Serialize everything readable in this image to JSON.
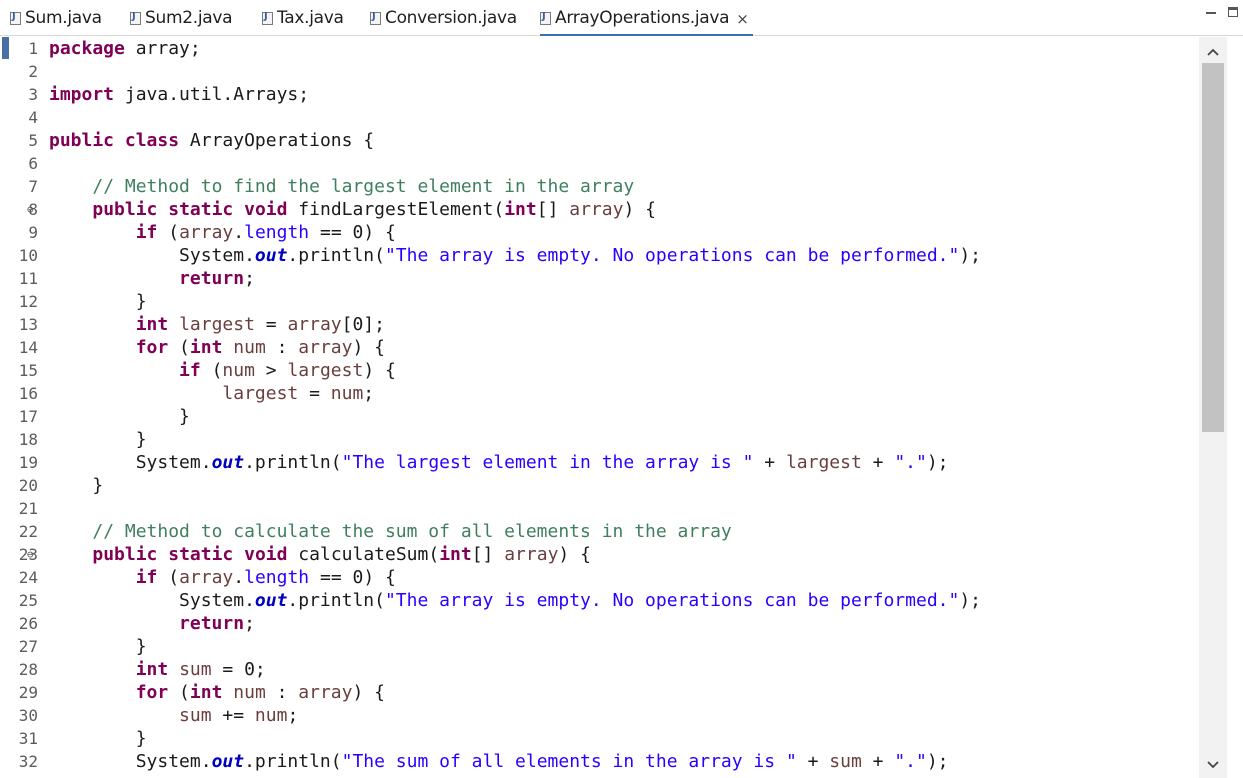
{
  "tabs": [
    {
      "label": "Sum.java",
      "active": false
    },
    {
      "label": "Sum2.java",
      "active": false
    },
    {
      "label": "Tax.java",
      "active": false
    },
    {
      "label": "Conversion.java",
      "active": false
    },
    {
      "label": "ArrayOperations.java",
      "active": true
    }
  ],
  "icons": {
    "file": "java-file-icon",
    "close": "×",
    "scroll_up": "chevron-up-icon",
    "scroll_down": "chevron-down-icon",
    "fold": "fold-collapse-icon"
  },
  "colors": {
    "keyword": "#7f0055",
    "string": "#2a00ff",
    "comment": "#3f7f5f",
    "static_field": "#0000c0",
    "parameter": "#6a3e3e",
    "active_tab_underline": "#3b6fb6"
  },
  "code_lines": [
    {
      "n": "1",
      "fold": false,
      "tokens": [
        [
          "kw",
          "package"
        ],
        [
          "p",
          " array;"
        ]
      ]
    },
    {
      "n": "2",
      "fold": false,
      "tokens": []
    },
    {
      "n": "3",
      "fold": false,
      "tokens": [
        [
          "kw",
          "import"
        ],
        [
          "p",
          " java.util.Arrays;"
        ]
      ]
    },
    {
      "n": "4",
      "fold": false,
      "tokens": []
    },
    {
      "n": "5",
      "fold": false,
      "tokens": [
        [
          "kw",
          "public"
        ],
        [
          "p",
          " "
        ],
        [
          "kw",
          "class"
        ],
        [
          "p",
          " ArrayOperations {"
        ]
      ]
    },
    {
      "n": "6",
      "fold": false,
      "tokens": []
    },
    {
      "n": "7",
      "fold": false,
      "tokens": [
        [
          "p",
          "    "
        ],
        [
          "cmt",
          "// Method to find the largest element in the array"
        ]
      ]
    },
    {
      "n": "8",
      "fold": true,
      "tokens": [
        [
          "p",
          "    "
        ],
        [
          "kw",
          "public"
        ],
        [
          "p",
          " "
        ],
        [
          "kw",
          "static"
        ],
        [
          "p",
          " "
        ],
        [
          "kw",
          "void"
        ],
        [
          "p",
          " findLargestElement("
        ],
        [
          "kw",
          "int"
        ],
        [
          "p",
          "[] "
        ],
        [
          "var",
          "array"
        ],
        [
          "p",
          ") {"
        ]
      ]
    },
    {
      "n": "9",
      "fold": false,
      "tokens": [
        [
          "p",
          "        "
        ],
        [
          "kw",
          "if"
        ],
        [
          "p",
          " ("
        ],
        [
          "var",
          "array"
        ],
        [
          "p",
          "."
        ],
        [
          "fld2",
          "length"
        ],
        [
          "p",
          " == 0) {"
        ]
      ]
    },
    {
      "n": "10",
      "fold": false,
      "tokens": [
        [
          "p",
          "            System."
        ],
        [
          "fld",
          "out"
        ],
        [
          "p",
          ".println("
        ],
        [
          "str",
          "\"The array is empty. No operations can be performed.\""
        ],
        [
          "p",
          ");"
        ]
      ]
    },
    {
      "n": "11",
      "fold": false,
      "tokens": [
        [
          "p",
          "            "
        ],
        [
          "kw",
          "return"
        ],
        [
          "p",
          ";"
        ]
      ]
    },
    {
      "n": "12",
      "fold": false,
      "tokens": [
        [
          "p",
          "        }"
        ]
      ]
    },
    {
      "n": "13",
      "fold": false,
      "tokens": [
        [
          "p",
          "        "
        ],
        [
          "kw",
          "int"
        ],
        [
          "p",
          " "
        ],
        [
          "var",
          "largest"
        ],
        [
          "p",
          " = "
        ],
        [
          "var",
          "array"
        ],
        [
          "p",
          "[0];"
        ]
      ]
    },
    {
      "n": "14",
      "fold": false,
      "tokens": [
        [
          "p",
          "        "
        ],
        [
          "kw",
          "for"
        ],
        [
          "p",
          " ("
        ],
        [
          "kw",
          "int"
        ],
        [
          "p",
          " "
        ],
        [
          "var",
          "num"
        ],
        [
          "p",
          " : "
        ],
        [
          "var",
          "array"
        ],
        [
          "p",
          ") {"
        ]
      ]
    },
    {
      "n": "15",
      "fold": false,
      "tokens": [
        [
          "p",
          "            "
        ],
        [
          "kw",
          "if"
        ],
        [
          "p",
          " ("
        ],
        [
          "var",
          "num"
        ],
        [
          "p",
          " > "
        ],
        [
          "var",
          "largest"
        ],
        [
          "p",
          ") {"
        ]
      ]
    },
    {
      "n": "16",
      "fold": false,
      "tokens": [
        [
          "p",
          "                "
        ],
        [
          "var",
          "largest"
        ],
        [
          "p",
          " = "
        ],
        [
          "var",
          "num"
        ],
        [
          "p",
          ";"
        ]
      ]
    },
    {
      "n": "17",
      "fold": false,
      "tokens": [
        [
          "p",
          "            }"
        ]
      ]
    },
    {
      "n": "18",
      "fold": false,
      "tokens": [
        [
          "p",
          "        }"
        ]
      ]
    },
    {
      "n": "19",
      "fold": false,
      "tokens": [
        [
          "p",
          "        System."
        ],
        [
          "fld",
          "out"
        ],
        [
          "p",
          ".println("
        ],
        [
          "str",
          "\"The largest element in the array is \""
        ],
        [
          "p",
          " + "
        ],
        [
          "var",
          "largest"
        ],
        [
          "p",
          " + "
        ],
        [
          "str",
          "\".\""
        ],
        [
          "p",
          ");"
        ]
      ]
    },
    {
      "n": "20",
      "fold": false,
      "tokens": [
        [
          "p",
          "    }"
        ]
      ]
    },
    {
      "n": "21",
      "fold": false,
      "tokens": []
    },
    {
      "n": "22",
      "fold": false,
      "tokens": [
        [
          "p",
          "    "
        ],
        [
          "cmt",
          "// Method to calculate the sum of all elements in the array"
        ]
      ]
    },
    {
      "n": "23",
      "fold": true,
      "tokens": [
        [
          "p",
          "    "
        ],
        [
          "kw",
          "public"
        ],
        [
          "p",
          " "
        ],
        [
          "kw",
          "static"
        ],
        [
          "p",
          " "
        ],
        [
          "kw",
          "void"
        ],
        [
          "p",
          " calculateSum("
        ],
        [
          "kw",
          "int"
        ],
        [
          "p",
          "[] "
        ],
        [
          "var",
          "array"
        ],
        [
          "p",
          ") {"
        ]
      ]
    },
    {
      "n": "24",
      "fold": false,
      "tokens": [
        [
          "p",
          "        "
        ],
        [
          "kw",
          "if"
        ],
        [
          "p",
          " ("
        ],
        [
          "var",
          "array"
        ],
        [
          "p",
          "."
        ],
        [
          "fld2",
          "length"
        ],
        [
          "p",
          " == 0) {"
        ]
      ]
    },
    {
      "n": "25",
      "fold": false,
      "tokens": [
        [
          "p",
          "            System."
        ],
        [
          "fld",
          "out"
        ],
        [
          "p",
          ".println("
        ],
        [
          "str",
          "\"The array is empty. No operations can be performed.\""
        ],
        [
          "p",
          ");"
        ]
      ]
    },
    {
      "n": "26",
      "fold": false,
      "tokens": [
        [
          "p",
          "            "
        ],
        [
          "kw",
          "return"
        ],
        [
          "p",
          ";"
        ]
      ]
    },
    {
      "n": "27",
      "fold": false,
      "tokens": [
        [
          "p",
          "        }"
        ]
      ]
    },
    {
      "n": "28",
      "fold": false,
      "tokens": [
        [
          "p",
          "        "
        ],
        [
          "kw",
          "int"
        ],
        [
          "p",
          " "
        ],
        [
          "var",
          "sum"
        ],
        [
          "p",
          " = 0;"
        ]
      ]
    },
    {
      "n": "29",
      "fold": false,
      "tokens": [
        [
          "p",
          "        "
        ],
        [
          "kw",
          "for"
        ],
        [
          "p",
          " ("
        ],
        [
          "kw",
          "int"
        ],
        [
          "p",
          " "
        ],
        [
          "var",
          "num"
        ],
        [
          "p",
          " : "
        ],
        [
          "var",
          "array"
        ],
        [
          "p",
          ") {"
        ]
      ]
    },
    {
      "n": "30",
      "fold": false,
      "tokens": [
        [
          "p",
          "            "
        ],
        [
          "var",
          "sum"
        ],
        [
          "p",
          " += "
        ],
        [
          "var",
          "num"
        ],
        [
          "p",
          ";"
        ]
      ]
    },
    {
      "n": "31",
      "fold": false,
      "tokens": [
        [
          "p",
          "        }"
        ]
      ]
    },
    {
      "n": "32",
      "fold": false,
      "tokens": [
        [
          "p",
          "        System."
        ],
        [
          "fld",
          "out"
        ],
        [
          "p",
          ".println("
        ],
        [
          "str",
          "\"The sum of all elements in the array is \""
        ],
        [
          "p",
          " + "
        ],
        [
          "var",
          "sum"
        ],
        [
          "p",
          " + "
        ],
        [
          "str",
          "\".\""
        ],
        [
          "p",
          ");"
        ]
      ]
    }
  ]
}
